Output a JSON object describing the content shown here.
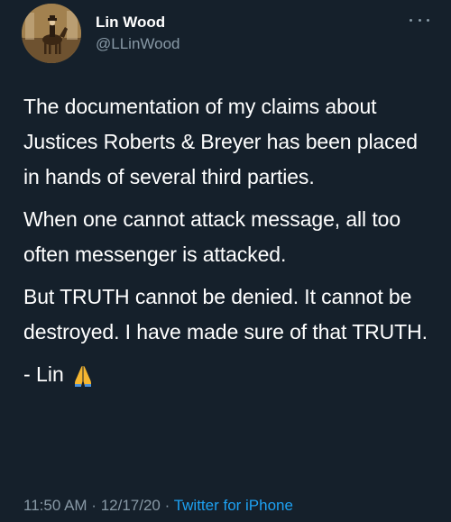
{
  "user": {
    "display_name": "Lin Wood",
    "handle": "@LLinWood"
  },
  "tweet": {
    "paragraphs": [
      "The documentation of my claims about Justices Roberts & Breyer has been placed in hands of several third parties.",
      "When one cannot attack message, all too often messenger is attacked.",
      "But TRUTH cannot be denied. It cannot be destroyed. I have made sure of that TRUTH."
    ],
    "signoff": "- Lin",
    "emoji_icon": "folded-hands-icon"
  },
  "meta": {
    "time": "11:50 AM",
    "separator": " · ",
    "date": "12/17/20",
    "source": "Twitter for iPhone"
  },
  "colors": {
    "background": "#15202b",
    "text_primary": "#ffffff",
    "text_secondary": "#8899a6",
    "link": "#1da1f2",
    "emoji": "#f5b631"
  }
}
